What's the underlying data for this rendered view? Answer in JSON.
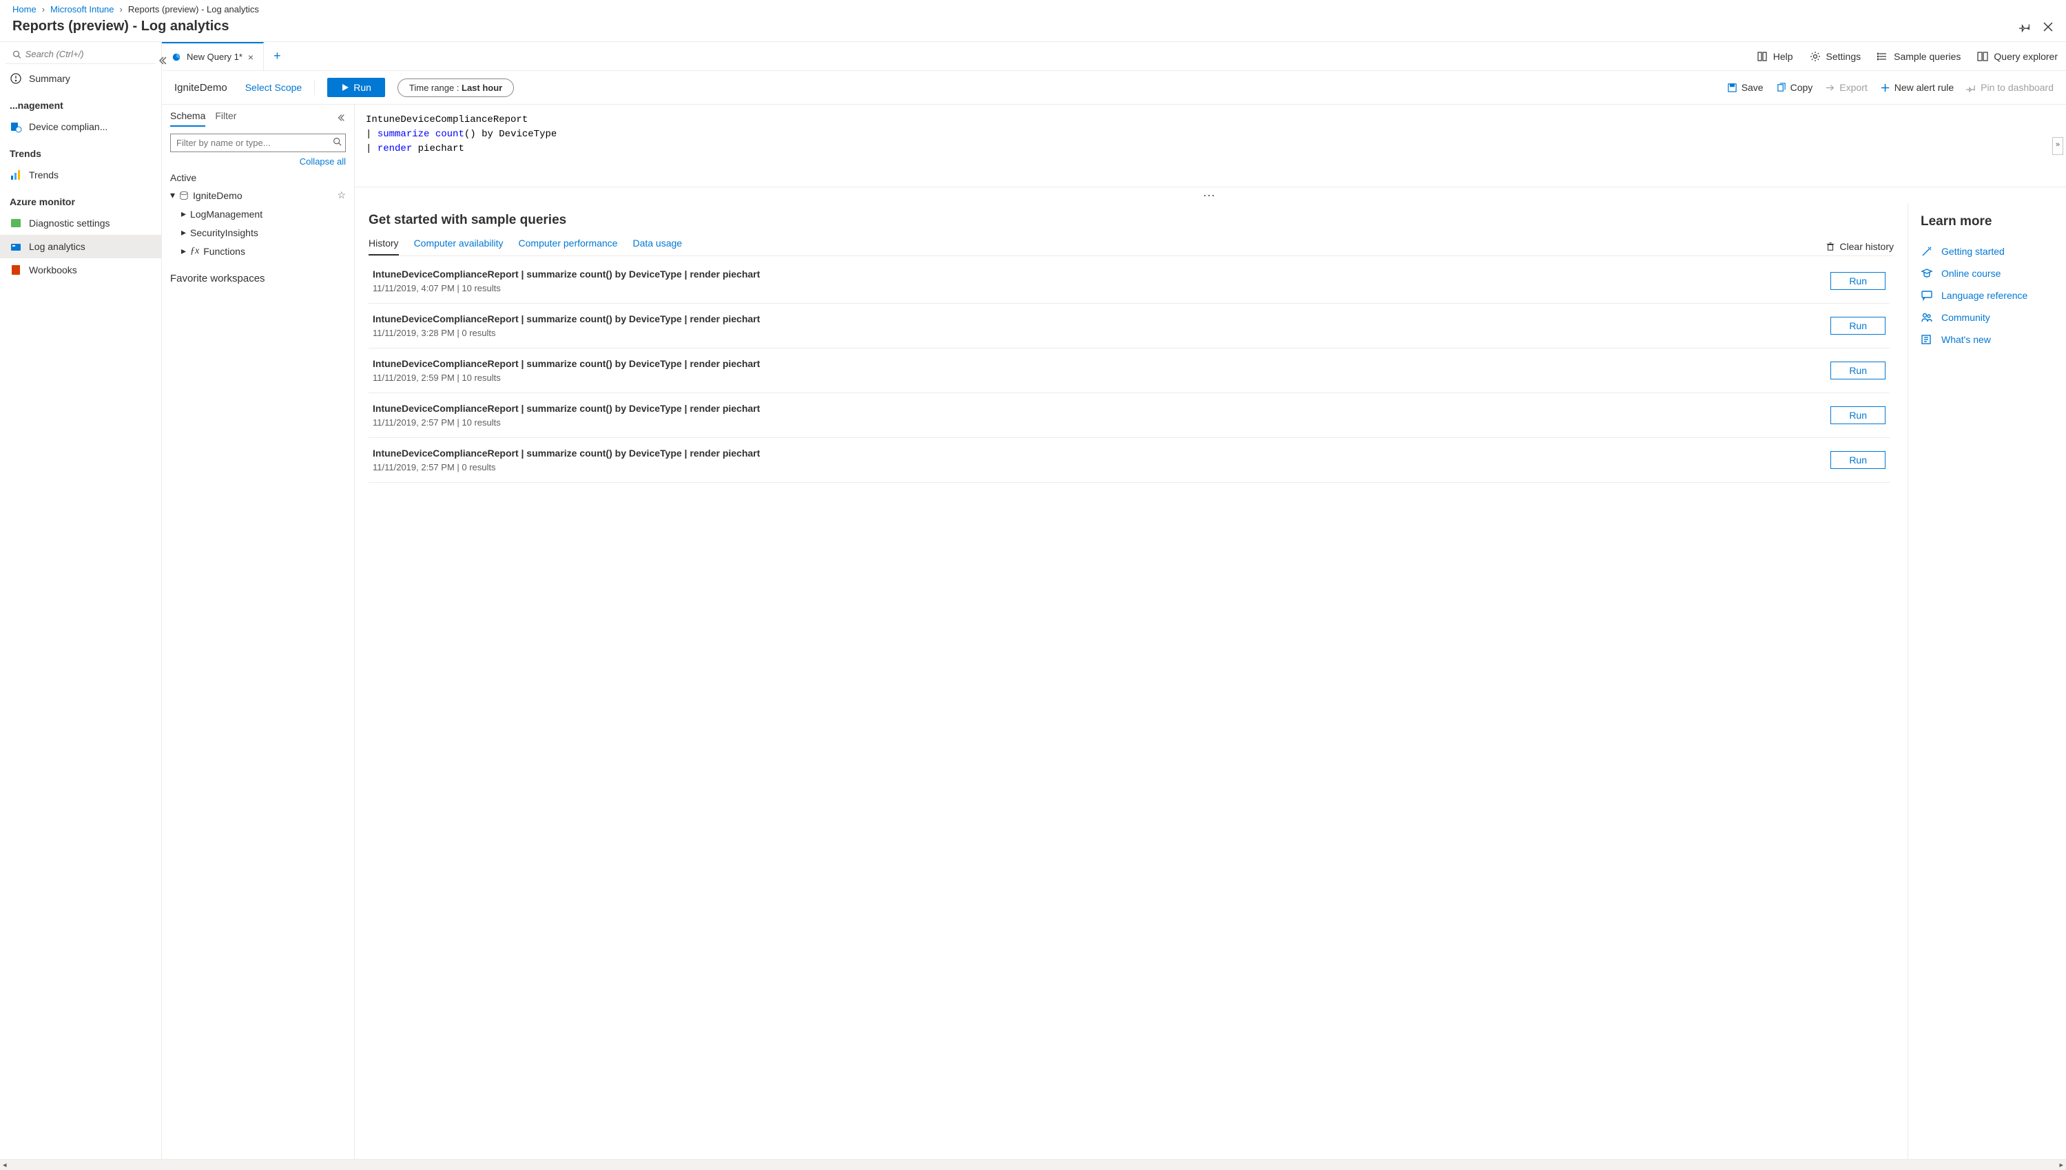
{
  "breadcrumb": {
    "home": "Home",
    "intune": "Microsoft Intune",
    "current": "Reports (preview) - Log analytics"
  },
  "page_title": "Reports (preview) - Log analytics",
  "sidebar": {
    "search_placeholder": "Search (Ctrl+/)",
    "summary": "Summary",
    "group_manage": "...nagement",
    "device_compl": "Device complian...",
    "trends_section": "Trends",
    "trends": "Trends",
    "azure_section": "Azure monitor",
    "diag": "Diagnostic settings",
    "log_analytics": "Log analytics",
    "workbooks": "Workbooks"
  },
  "tabstrip": {
    "tab1_label": "New Query 1*",
    "help": "Help",
    "settings": "Settings",
    "sample_queries": "Sample queries",
    "query_explorer": "Query explorer"
  },
  "actionbar": {
    "workspace": "IgniteDemo",
    "select_scope": "Select Scope",
    "run": "Run",
    "time_label": "Time range : ",
    "time_value": "Last hour",
    "save": "Save",
    "copy": "Copy",
    "export": "Export",
    "new_alert": "New alert rule",
    "pin": "Pin to dashboard"
  },
  "schema": {
    "tab_schema": "Schema",
    "tab_filter": "Filter",
    "filter_placeholder": "Filter by name or type...",
    "collapse_all": "Collapse all",
    "active_label": "Active",
    "workspace": "IgniteDemo",
    "logmgmt": "LogManagement",
    "security": "SecurityInsights",
    "functions": "Functions",
    "favorites_label": "Favorite workspaces"
  },
  "editor": {
    "line1_a": "IntuneDeviceComplianceReport",
    "line2_pipe": "| ",
    "line2_op": "summarize",
    "line2_func": " count",
    "line2_rest": "() by DeviceType",
    "line3_pipe": "| ",
    "line3_op": "render",
    "line3_rest": " piechart"
  },
  "samples": {
    "title": "Get started with sample queries",
    "tabs": {
      "history": "History",
      "avail": "Computer availability",
      "perf": "Computer performance",
      "data": "Data usage"
    },
    "clear": "Clear history",
    "run_label": "Run",
    "items": [
      {
        "q": "IntuneDeviceComplianceReport | summarize count() by DeviceType | render piechart",
        "ts": "11/11/2019, 4:07 PM | 10 results"
      },
      {
        "q": "IntuneDeviceComplianceReport | summarize count() by DeviceType | render piechart",
        "ts": "11/11/2019, 3:28 PM | 0 results"
      },
      {
        "q": "IntuneDeviceComplianceReport | summarize count() by DeviceType | render piechart",
        "ts": "11/11/2019, 2:59 PM | 10 results"
      },
      {
        "q": "IntuneDeviceComplianceReport | summarize count() by DeviceType | render piechart",
        "ts": "11/11/2019, 2:57 PM | 10 results"
      },
      {
        "q": "IntuneDeviceComplianceReport | summarize count() by DeviceType | render piechart",
        "ts": "11/11/2019, 2:57 PM | 0 results"
      }
    ]
  },
  "learn": {
    "title": "Learn more",
    "links": {
      "started": "Getting started",
      "course": "Online course",
      "lang": "Language reference",
      "community": "Community",
      "whatsnew": "What's new"
    }
  }
}
